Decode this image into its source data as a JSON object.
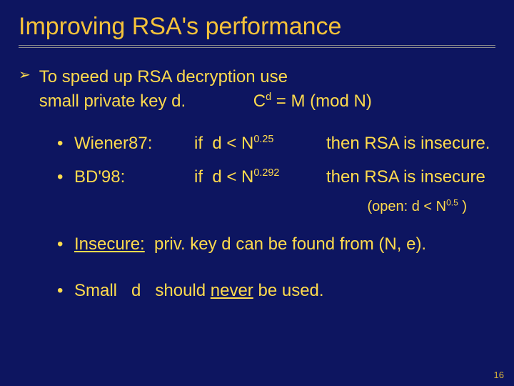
{
  "title": "Improving RSA's performance",
  "lead": {
    "l1": "To speed up RSA decryption use",
    "l2a": "small private key  d.",
    "l2b_html": "C<sup>d</sup> = M  (mod N)"
  },
  "attacks": [
    {
      "name": "Wiener87:",
      "cond_html": "if&nbsp;&nbsp;d &lt; N<sup>0.25</sup>",
      "result": "then RSA is insecure."
    },
    {
      "name": "BD'98:",
      "cond_html": "if&nbsp;&nbsp;d &lt; N<sup>0.292</sup>",
      "result": "then RSA is insecure"
    }
  ],
  "open_note_html": "(open:  d &lt; N<sup>0.5</sup>  )",
  "insecure_html": "<span class=\"underline\">Insecure:</span>&nbsp; priv. key  d  can be found from  (N, e).",
  "warn_html": "Small &nbsp; d &nbsp; should <span class=\"underline\">never</span> be used.",
  "page": "16"
}
